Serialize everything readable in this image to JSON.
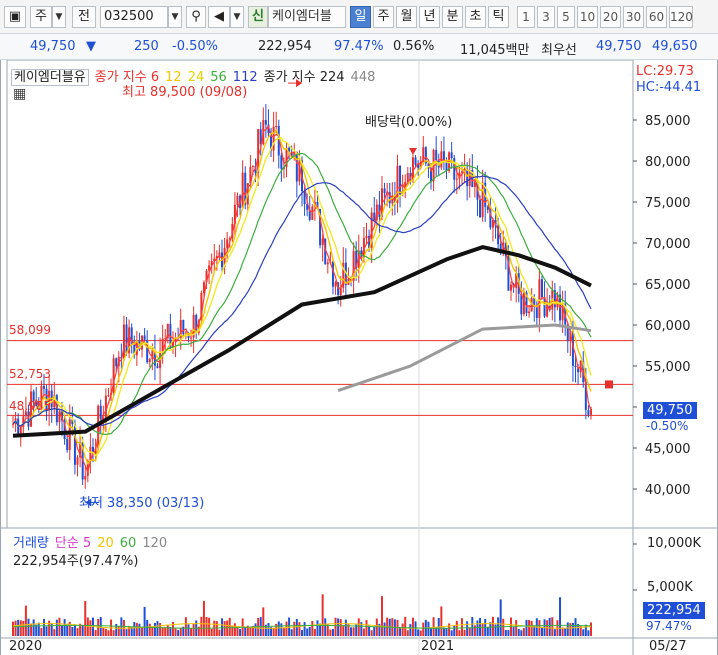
{
  "toolbar": {
    "type_label": "주",
    "market_label": "전",
    "code": "032500",
    "logo": "신",
    "stock_name": "케이엠더블",
    "periods": [
      "일",
      "주",
      "월",
      "년",
      "분",
      "초",
      "틱"
    ],
    "selected_period": "일",
    "intervals": [
      "1",
      "3",
      "5",
      "10",
      "20",
      "30",
      "60",
      "120"
    ]
  },
  "quote": {
    "price": "49,750",
    "arrow": "▼",
    "change": "250",
    "change_pct": "-0.50%",
    "volume": "222,954",
    "volume_ratio": "97.47%",
    "turnover_pct": "0.56%",
    "trade_value": "11,045백만",
    "best_ask_label": "최우선",
    "best_ask": "49,750",
    "best_bid": "49,650"
  },
  "legend": {
    "stock_name": "케이엠더블유",
    "ma_label": "종가 지수 6",
    "ma_periods": [
      "12",
      "24",
      "56",
      "112"
    ],
    "ma2_label": "종가 지수 224",
    "ma2_period": "448",
    "lc": "LC:29.73",
    "hc": "HC:-44.41"
  },
  "annotations": {
    "high": "최고 89,500 (09/08)",
    "low": "최저 38,350 (03/13)",
    "dividend": "배당락(0.00%)",
    "line_58099": "58,099",
    "line_52": "52,753",
    "line_48": "48,985"
  },
  "price_tag": {
    "value": "49,750",
    "pct": "-0.50%"
  },
  "volume_panel": {
    "legend_label": "거래량",
    "ma_label": "단순 5",
    "ma_periods": [
      "20",
      "60",
      "120"
    ],
    "current": "222,954주(97.47%)",
    "axis_top": "10,000K",
    "axis_mid": "5,000K",
    "vol_tag": "222,954",
    "vol_pct": "97.47%"
  },
  "x_axis": {
    "labels": [
      "2020",
      "2021"
    ],
    "date_label": "05/27"
  },
  "colors": {
    "up": "#e8302c",
    "down": "#1f4fd6",
    "ma6": "#ff3b3b",
    "ma12": "#f5c400",
    "ma24": "#f2ea28",
    "ma56": "#3cae3c",
    "ma112": "#2b3ec4",
    "ma224": "#111111",
    "ma448": "#9a9a9a",
    "hline": "#e8302c"
  },
  "chart_data": {
    "type": "line",
    "title": "",
    "x": [
      "2020",
      "2021"
    ],
    "ylim": [
      35000,
      90000
    ],
    "yticks": [
      40000,
      45000,
      50000,
      55000,
      60000,
      65000,
      70000,
      75000,
      80000,
      85000
    ],
    "close_series": [
      {
        "date": "2020-01",
        "value": 48000
      },
      {
        "date": "2020-02",
        "value": 52000
      },
      {
        "date": "2020-03",
        "value": 42000
      },
      {
        "date": "2020-04",
        "value": 58000
      },
      {
        "date": "2020-05",
        "value": 57000
      },
      {
        "date": "2020-06",
        "value": 60000
      },
      {
        "date": "2020-07",
        "value": 72000
      },
      {
        "date": "2020-08",
        "value": 84000
      },
      {
        "date": "2020-09",
        "value": 78000
      },
      {
        "date": "2020-10",
        "value": 65000
      },
      {
        "date": "2020-11",
        "value": 73000
      },
      {
        "date": "2020-12",
        "value": 80000
      },
      {
        "date": "2021-01",
        "value": 79000
      },
      {
        "date": "2021-02",
        "value": 75000
      },
      {
        "date": "2021-03",
        "value": 63000
      },
      {
        "date": "2021-04",
        "value": 63500
      },
      {
        "date": "2021-05",
        "value": 49750
      }
    ],
    "ma224": [
      {
        "date": "2020-01",
        "value": 46500
      },
      {
        "date": "2020-03",
        "value": 47000
      },
      {
        "date": "2020-05",
        "value": 52000
      },
      {
        "date": "2020-07",
        "value": 57000
      },
      {
        "date": "2020-09",
        "value": 62500
      },
      {
        "date": "2020-11",
        "value": 64000
      },
      {
        "date": "2021-01",
        "value": 68000
      },
      {
        "date": "2021-02",
        "value": 69500
      },
      {
        "date": "2021-03",
        "value": 68500
      },
      {
        "date": "2021-04",
        "value": 67000
      },
      {
        "date": "2021-05",
        "value": 64800
      }
    ],
    "ma448": [
      {
        "date": "2020-10",
        "value": 52000
      },
      {
        "date": "2020-12",
        "value": 55000
      },
      {
        "date": "2021-02",
        "value": 59500
      },
      {
        "date": "2021-04",
        "value": 60000
      },
      {
        "date": "2021-05",
        "value": 59300
      }
    ],
    "hlines": [
      58099,
      52753,
      48985
    ],
    "high": {
      "date": "2020-09-08",
      "value": 89500
    },
    "low": {
      "date": "2020-03-13",
      "value": 38350
    },
    "current": 49750,
    "volume_ylim": [
      0,
      10000000
    ],
    "volume_yticks": [
      5000000,
      10000000
    ]
  }
}
